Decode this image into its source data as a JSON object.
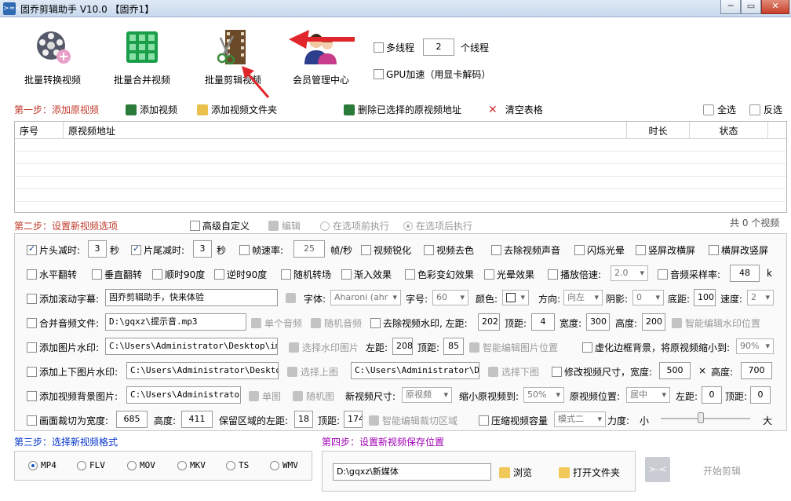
{
  "window": {
    "title": "固乔剪辑助手 V10.0 【固乔1】",
    "icon_text": ">≈<",
    "min": "─",
    "max": "▭",
    "close": "✕"
  },
  "toolbar": {
    "batch_convert": "批量转换视频",
    "batch_merge": "批量合并视频",
    "batch_edit": "批量剪辑视频",
    "member_center": "会员管理中心",
    "multithread": "多线程",
    "thread_count": "2",
    "thread_unit": "个线程",
    "gpu": "GPU加速（用显卡解码）"
  },
  "step1": {
    "title": "第一步：添加原视频",
    "add_video": "添加视频",
    "add_folder": "添加视频文件夹",
    "delete_selected": "删除已选择的原视频地址",
    "clear_table": "清空表格",
    "select_all": "全选",
    "invert": "反选",
    "columns": [
      "序号",
      "原视频地址",
      "时长",
      "状态"
    ],
    "count": "共 0 个视频"
  },
  "step2": {
    "title": "第二步：设置新视频选项",
    "advanced": "高级自定义",
    "edit": "编辑",
    "before": "在选项前执行",
    "after": "在选项后执行",
    "r1": {
      "head_cut": "片头减时:",
      "head_val": "3",
      "sec1": "秒",
      "tail_cut": "片尾减时:",
      "tail_val": "3",
      "sec2": "秒",
      "fps": "帧速率:",
      "fps_val": "25",
      "fps_unit": "帧/秒",
      "sharpen": "视频锐化",
      "decolor": "视频去色",
      "mute": "去除视频声音",
      "flash": "闪烁光晕",
      "v2h": "竖屏改横屏",
      "h2v": "横屏改竖屏"
    },
    "r2": {
      "hflip": "水平翻转",
      "vflip": "垂直翻转",
      "rot90": "顺时90度",
      "rot_ccw90": "逆时90度",
      "rand_trans": "随机转场",
      "fade": "渐入效果",
      "color": "色彩变幻效果",
      "glow": "光晕效果",
      "speed": "播放倍速:",
      "speed_val": "2.0",
      "samplerate": "音频采样率:",
      "sr_val": "48",
      "sr_unit": "k"
    },
    "r3": {
      "scroll": "添加滚动字幕:",
      "scroll_text": "固乔剪辑助手，快来体验",
      "font": "字体:",
      "font_val": "Aharoni (ahr",
      "size": "字号:",
      "size_val": "60",
      "color": "颜色:",
      "dir": "方向:",
      "dir_val": "向左",
      "shadow": "阴影:",
      "shadow_val": "0",
      "bottom": "底距:",
      "bottom_val": "100",
      "speed": "速度:",
      "speed_val": "2"
    },
    "r4": {
      "merge_audio": "合并音频文件:",
      "audio_path": "D:\\gqxz\\提示音.mp3",
      "single": "单个音频",
      "random": "随机音频",
      "rm_wm": "去除视频水印, 左距:",
      "left": "202",
      "top_lbl": "顶距:",
      "top": "4",
      "width_lbl": "宽度:",
      "width": "300",
      "height_lbl": "高度:",
      "height": "200",
      "smart": "智能编辑水印位置"
    },
    "r5": {
      "img_wm": "添加图片水印:",
      "img_path": "C:\\Users\\Administrator\\Desktop\\img-q",
      "choose": "选择水印图片",
      "left_lbl": "左距:",
      "left": "208",
      "top_lbl": "顶距:",
      "top": "85",
      "smart": "智能编辑图片位置",
      "blur": "虚化边框背景，将原视频缩小到:",
      "blur_val": "90%"
    },
    "r6": {
      "tb_img": "添加上下图片水印:",
      "top_path": "C:\\Users\\Administrator\\Desktop\\i",
      "choose_top": "选择上图",
      "bot_path": "C:\\Users\\Administrator\\Desk",
      "choose_bot": "选择下图",
      "resize": "修改视频尺寸，宽度:",
      "w": "500",
      "x": "×",
      "h_lbl": "高度:",
      "h": "700"
    },
    "r7": {
      "bg_img": "添加视频背景图片:",
      "bg_path": "C:\\Users\\Administrator\\D",
      "single": "单图",
      "random": "随机图",
      "new_size": "新视频尺寸:",
      "new_size_val": "原视频",
      "shrink": "缩小原视频到:",
      "shrink_val": "50%",
      "pos": "原视频位置:",
      "pos_val": "居中",
      "left_lbl": "左距:",
      "left": "0",
      "top_lbl": "顶距:",
      "top": "0"
    },
    "r8": {
      "crop": "画面裁切为宽度:",
      "w": "685",
      "h_lbl": "高度:",
      "h": "411",
      "keep_left": "保留区域的左距:",
      "left": "18",
      "top_lbl": "顶距:",
      "top": "174",
      "smart": "智能编辑裁切区域",
      "compress": "压缩视频容量",
      "mode": "模式二",
      "force": "力度:",
      "small": "小",
      "big": "大",
      "strength_fraction": 0.45
    }
  },
  "step3": {
    "title": "第三步：选择新视频格式",
    "formats": [
      "MP4",
      "FLV",
      "MOV",
      "MKV",
      "TS",
      "WMV"
    ],
    "selected": "MP4"
  },
  "step4": {
    "title": "第四步：设置新视频保存位置",
    "path": "D:\\gqxz\\新媒体",
    "browse": "浏览",
    "open": "打开文件夹",
    "start": "开始剪辑",
    "start_icon": ">-<"
  },
  "colors": {
    "red_step": "#c0392b",
    "blue_step": "#0033cc",
    "purple_step": "#a100b5",
    "arrow": "#e0262a"
  }
}
